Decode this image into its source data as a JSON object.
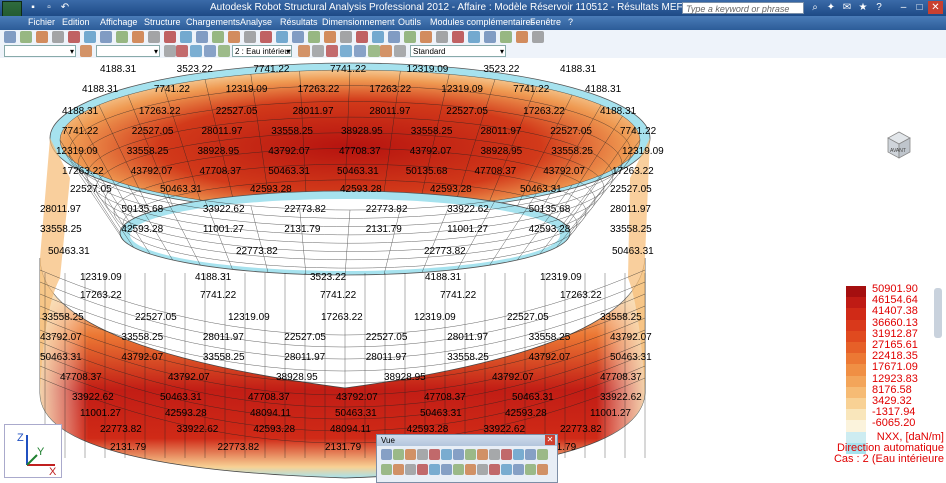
{
  "window": {
    "title": "Autodesk Robot Structural Analysis Professional 2012 - Affaire : Modèle Réservoir  110512 - Résultats MEF : actuels",
    "search_placeholder": "Type a keyword or phrase"
  },
  "menu": [
    "Fichier",
    "Edition",
    "Affichage",
    "Structure",
    "Chargements",
    "Analyse",
    "Résultats",
    "Dimensionnement",
    "Outils",
    "Modules complémentaires",
    "Fenêtre",
    "?"
  ],
  "toolbar": {
    "combo1": "",
    "combo2": "",
    "case_combo": "2 : Eau intérieure",
    "view_combo": "Standard"
  },
  "colors": {
    "legend": [
      "#a50f0f",
      "#bf1b14",
      "#d02a17",
      "#d9391b",
      "#e04a1f",
      "#e66028",
      "#ec7834",
      "#f08f44",
      "#f3a55a",
      "#f6bb74",
      "#f8d194",
      "#f9e6bb",
      "#fbf3dc",
      "#cdecf1",
      "#a6e2ee"
    ]
  },
  "legend": {
    "values": [
      "50901.90",
      "46154.64",
      "41407.38",
      "36660.13",
      "31912.87",
      "27165.61",
      "22418.35",
      "17671.09",
      "12923.83",
      "8176.58",
      "3429.32",
      "-1317.94",
      "-6065.20"
    ],
    "unit": "NXX, [daN/m]",
    "direction": "Direction automatique",
    "case": "Cas : 2 (Eau intérieure"
  },
  "vue_panel": {
    "title": "Vue"
  },
  "view_cube": {
    "label": "AVANT"
  },
  "axes": {
    "z": "Z",
    "y": "Y",
    "x": "X"
  },
  "labels": [
    {
      "t": "4188.31"
    },
    {
      "t": "3523.22"
    },
    {
      "t": "7741.22"
    },
    {
      "t": "7741.22"
    },
    {
      "t": "12319.09"
    },
    {
      "t": "3523.22"
    },
    {
      "t": "4188.31"
    },
    {
      "t": "4188.31"
    },
    {
      "t": "7741.22"
    },
    {
      "t": "12319.09"
    },
    {
      "t": "17263.22"
    },
    {
      "t": "17263.22"
    },
    {
      "t": "12319.09"
    },
    {
      "t": "7741.22"
    },
    {
      "t": "4188.31"
    },
    {
      "t": "4188.31"
    },
    {
      "t": "17263.22"
    },
    {
      "t": "22527.05"
    },
    {
      "t": "28011.97"
    },
    {
      "t": "28011.97"
    },
    {
      "t": "22527.05"
    },
    {
      "t": "17263.22"
    },
    {
      "t": "4188.31"
    },
    {
      "t": "7741.22"
    },
    {
      "t": "22527.05"
    },
    {
      "t": "28011.97"
    },
    {
      "t": "33558.25"
    },
    {
      "t": "38928.95"
    },
    {
      "t": "33558.25"
    },
    {
      "t": "28011.97"
    },
    {
      "t": "22527.05"
    },
    {
      "t": "7741.22"
    },
    {
      "t": "12319.09"
    },
    {
      "t": "33558.25"
    },
    {
      "t": "38928.95"
    },
    {
      "t": "43792.07"
    },
    {
      "t": "47708.37"
    },
    {
      "t": "43792.07"
    },
    {
      "t": "38928.95"
    },
    {
      "t": "33558.25"
    },
    {
      "t": "12319.09"
    },
    {
      "t": "17263.22"
    },
    {
      "t": "43792.07"
    },
    {
      "t": "47708.37"
    },
    {
      "t": "50463.31"
    },
    {
      "t": "50463.31"
    },
    {
      "t": "50135.68"
    },
    {
      "t": "47708.37"
    },
    {
      "t": "43792.07"
    },
    {
      "t": "17263.22"
    },
    {
      "t": "22527.05"
    },
    {
      "t": "50463.31"
    },
    {
      "t": "42593.28"
    },
    {
      "t": "42593.28"
    },
    {
      "t": "42593.28"
    },
    {
      "t": "50463.31"
    },
    {
      "t": "22527.05"
    },
    {
      "t": "28011.97"
    },
    {
      "t": "50135.68"
    },
    {
      "t": "33922.62"
    },
    {
      "t": "22773.82"
    },
    {
      "t": "22773.82"
    },
    {
      "t": "33922.62"
    },
    {
      "t": "50135.68"
    },
    {
      "t": "28011.97"
    },
    {
      "t": "33558.25"
    },
    {
      "t": "42593.28"
    },
    {
      "t": "11001.27"
    },
    {
      "t": "2131.79"
    },
    {
      "t": "2131.79"
    },
    {
      "t": "11001.27"
    },
    {
      "t": "42593.28"
    },
    {
      "t": "33558.25"
    },
    {
      "t": "50463.31"
    },
    {
      "t": "22773.82"
    },
    {
      "t": "22773.82"
    },
    {
      "t": "50463.31"
    },
    {
      "t": "12319.09"
    },
    {
      "t": "4188.31"
    },
    {
      "t": "3523.22"
    },
    {
      "t": "4188.31"
    },
    {
      "t": "12319.09"
    },
    {
      "t": "17263.22"
    },
    {
      "t": "7741.22"
    },
    {
      "t": "7741.22"
    },
    {
      "t": "7741.22"
    },
    {
      "t": "17263.22"
    },
    {
      "t": "33558.25"
    },
    {
      "t": "22527.05"
    },
    {
      "t": "12319.09"
    },
    {
      "t": "17263.22"
    },
    {
      "t": "12319.09"
    },
    {
      "t": "22527.05"
    },
    {
      "t": "33558.25"
    },
    {
      "t": "43792.07"
    },
    {
      "t": "33558.25"
    },
    {
      "t": "28011.97"
    },
    {
      "t": "22527.05"
    },
    {
      "t": "22527.05"
    },
    {
      "t": "28011.97"
    },
    {
      "t": "33558.25"
    },
    {
      "t": "43792.07"
    },
    {
      "t": "50463.31"
    },
    {
      "t": "43792.07"
    },
    {
      "t": "33558.25"
    },
    {
      "t": "28011.97"
    },
    {
      "t": "28011.97"
    },
    {
      "t": "33558.25"
    },
    {
      "t": "43792.07"
    },
    {
      "t": "50463.31"
    },
    {
      "t": "47708.37"
    },
    {
      "t": "43792.07"
    },
    {
      "t": "38928.95"
    },
    {
      "t": "38928.95"
    },
    {
      "t": "43792.07"
    },
    {
      "t": "47708.37"
    },
    {
      "t": "33922.62"
    },
    {
      "t": "50463.31"
    },
    {
      "t": "47708.37"
    },
    {
      "t": "43792.07"
    },
    {
      "t": "47708.37"
    },
    {
      "t": "50463.31"
    },
    {
      "t": "33922.62"
    },
    {
      "t": "11001.27"
    },
    {
      "t": "42593.28"
    },
    {
      "t": "48094.11"
    },
    {
      "t": "50463.31"
    },
    {
      "t": "50463.31"
    },
    {
      "t": "42593.28"
    },
    {
      "t": "11001.27"
    },
    {
      "t": "22773.82"
    },
    {
      "t": "33922.62"
    },
    {
      "t": "42593.28"
    },
    {
      "t": "48094.11"
    },
    {
      "t": "42593.28"
    },
    {
      "t": "33922.62"
    },
    {
      "t": "22773.82"
    },
    {
      "t": "2131.79"
    },
    {
      "t": "22773.82"
    },
    {
      "t": "2131.79"
    },
    {
      "t": "22773.82"
    },
    {
      "t": "2131.79"
    }
  ]
}
